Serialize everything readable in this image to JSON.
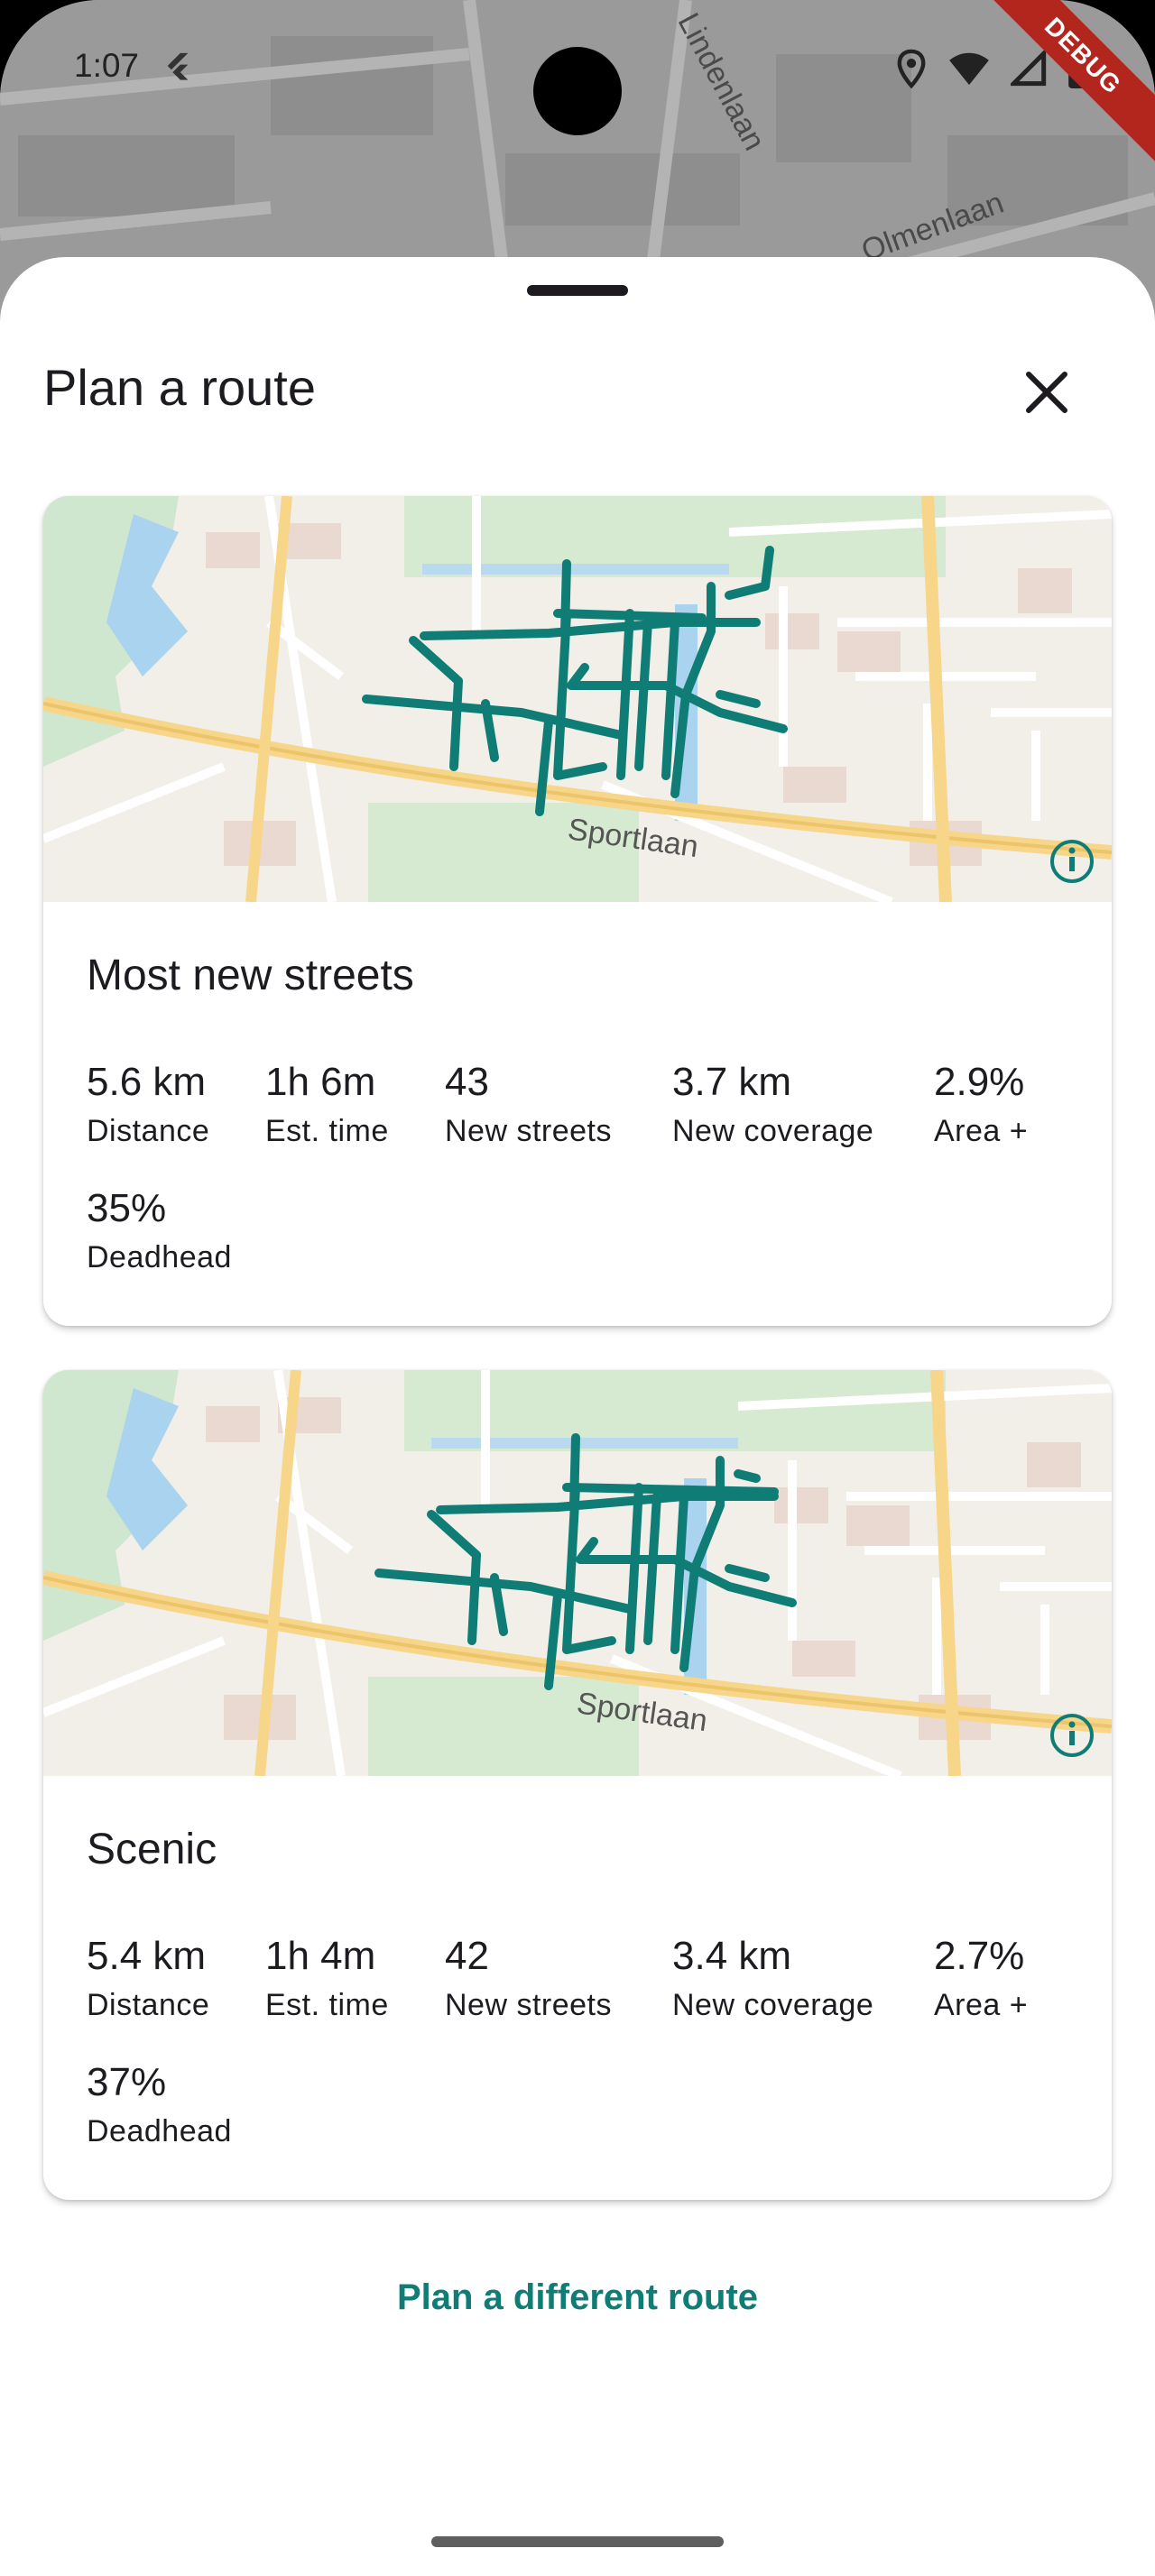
{
  "status_bar": {
    "time": "1:07",
    "debug_label": "DEBUG"
  },
  "background_map_labels": {
    "street_1": "Lindenlaan",
    "street_2": "Olmenlaan"
  },
  "sheet": {
    "title": "Plan a route",
    "close_icon": "close-icon"
  },
  "routes": [
    {
      "name": "Most new streets",
      "map_label": "Sportlaan",
      "stats": [
        {
          "value": "5.6 km",
          "label": "Distance"
        },
        {
          "value": "1h 6m",
          "label": "Est. time"
        },
        {
          "value": "43",
          "label": "New streets"
        },
        {
          "value": "3.7 km",
          "label": "New coverage"
        },
        {
          "value": "2.9%",
          "label": "Area +"
        },
        {
          "value": "35%",
          "label": "Deadhead"
        }
      ]
    },
    {
      "name": "Scenic",
      "map_label": "Sportlaan",
      "stats": [
        {
          "value": "5.4 km",
          "label": "Distance"
        },
        {
          "value": "1h 4m",
          "label": "Est. time"
        },
        {
          "value": "42",
          "label": "New streets"
        },
        {
          "value": "3.4 km",
          "label": "New coverage"
        },
        {
          "value": "2.7%",
          "label": "Area +"
        },
        {
          "value": "37%",
          "label": "Deadhead"
        }
      ]
    }
  ],
  "footer": {
    "alt_route_label": "Plan a different route"
  },
  "colors": {
    "accent": "#0f7d76",
    "route_line": "#0f7d76"
  }
}
